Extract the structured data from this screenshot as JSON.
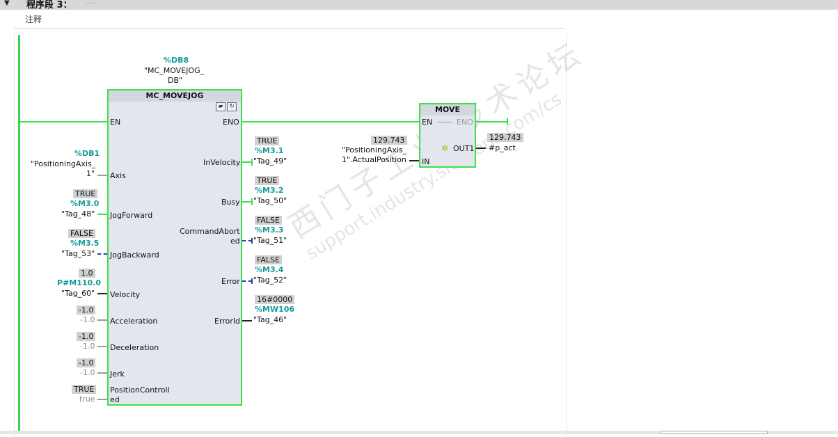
{
  "segment": {
    "title": "程序段 3：",
    "dots": "....."
  },
  "comment": {
    "label": "注释"
  },
  "fb": {
    "instance_db": "%DB8",
    "instance_name_l1": "\"MC_MOVEJOG_",
    "instance_name_l2": "DB\"",
    "title": "MC_MOVEJOG",
    "in_pins": [
      "EN",
      "Axis",
      "JogForward",
      "JogBackward",
      "Velocity",
      "Acceleration",
      "Deceleration",
      "Jerk",
      "PositionControll",
      "ed"
    ],
    "out_pins": [
      "ENO",
      "InVelocity",
      "Busy",
      "CommandAbort",
      "ed",
      "Error",
      "ErrorId"
    ]
  },
  "inputs": {
    "axis": {
      "addr": "%DB1",
      "tag_l1": "\"PositioningAxis_",
      "tag_l2": "1\""
    },
    "jogforward": {
      "value": "TRUE",
      "addr": "%M3.0",
      "tag": "\"Tag_48\""
    },
    "jogbackward": {
      "value": "FALSE",
      "addr": "%M3.5",
      "tag": "\"Tag_53\""
    },
    "velocity": {
      "value": "1.0",
      "addr": "P#M110.0",
      "tag": "\"Tag_60\""
    },
    "acceleration": {
      "value": "-1.0",
      "default": "-1.0"
    },
    "deceleration": {
      "value": "-1.0",
      "default": "-1.0"
    },
    "jerk": {
      "value": "-1.0",
      "default": "-1.0"
    },
    "poscontrolled": {
      "value": "TRUE",
      "default": "true"
    }
  },
  "outputs": {
    "invelocity": {
      "value": "TRUE",
      "addr": "%M3.1",
      "tag": "\"Tag_49\""
    },
    "busy": {
      "value": "TRUE",
      "addr": "%M3.2",
      "tag": "\"Tag_50\""
    },
    "commandaborted": {
      "value": "FALSE",
      "addr": "%M3.3",
      "tag": "\"Tag_51\""
    },
    "error": {
      "value": "FALSE",
      "addr": "%M3.4",
      "tag": "\"Tag_52\""
    },
    "errorid": {
      "value": "16#0000",
      "addr": "%MW106",
      "tag": "\"Tag_46\""
    }
  },
  "move": {
    "title": "MOVE",
    "pin_en": "EN",
    "pin_eno": "ENO",
    "pin_in": "IN",
    "pin_out": "OUT1",
    "in_value": "129.743",
    "in_tag_l1": "\"PositioningAxis_",
    "in_tag_l2": "1\".ActualPosition",
    "out_value": "129.743",
    "out_tag": "#p_act"
  },
  "watermark": {
    "line1": "西门子工业 技术论坛",
    "line2": "support.industry.siemens.com/cs"
  },
  "colors": {
    "power_flow": "#3ce04a",
    "address": "#169a9a",
    "no_flow": "#2a3ea8"
  }
}
